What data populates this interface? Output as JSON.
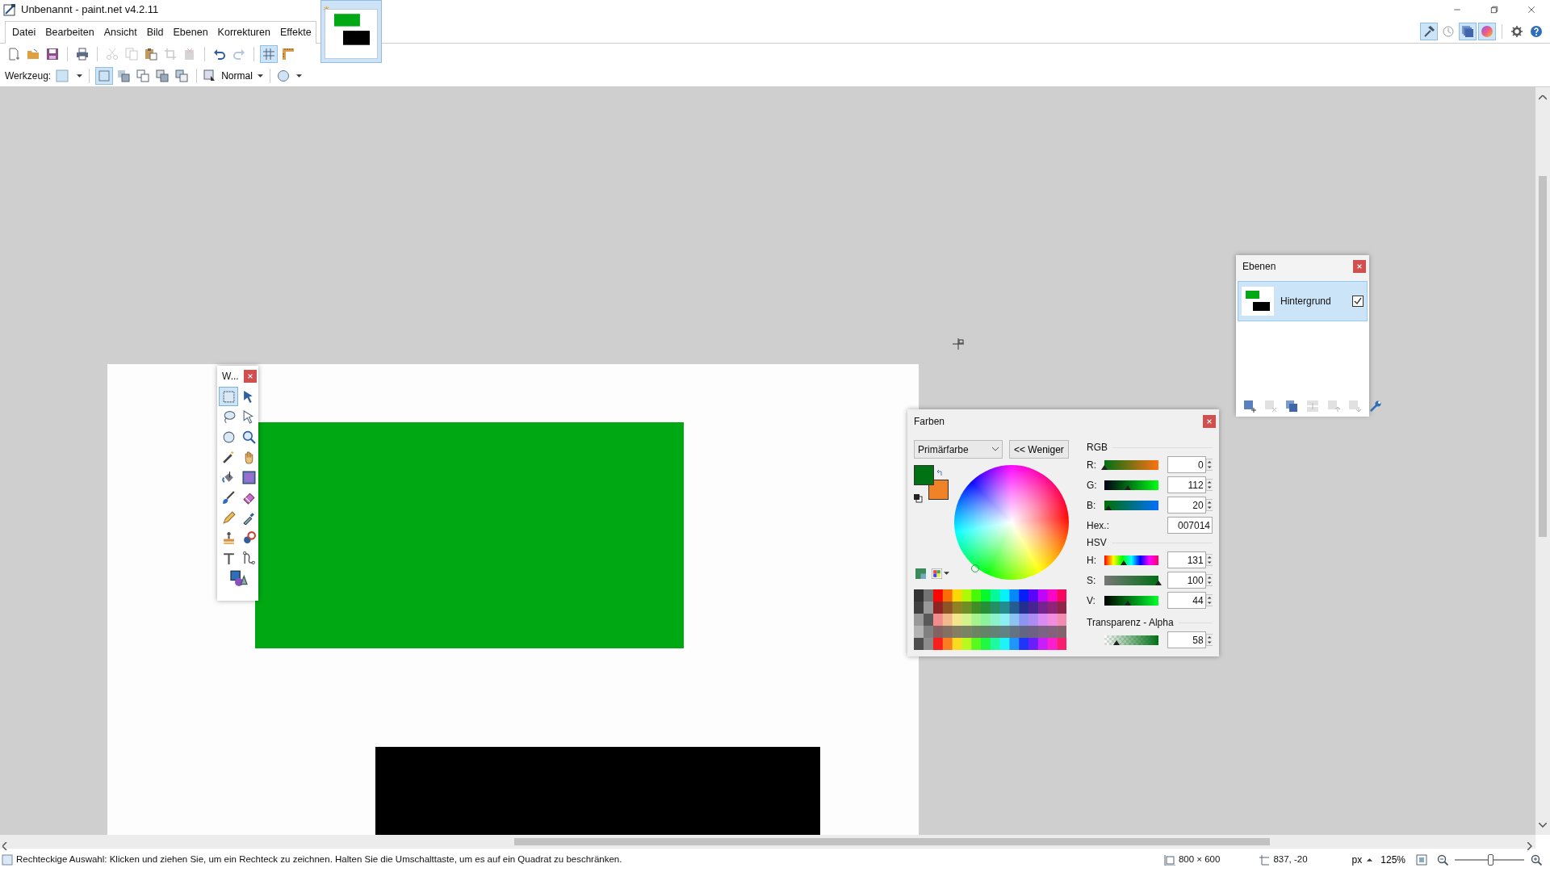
{
  "window": {
    "title": "Unbenannt - paint.net v4.2.11"
  },
  "menu": [
    {
      "label": "Datei"
    },
    {
      "label": "Bearbeiten"
    },
    {
      "label": "Ansicht"
    },
    {
      "label": "Bild"
    },
    {
      "label": "Ebenen"
    },
    {
      "label": "Korrekturen"
    },
    {
      "label": "Effekte"
    }
  ],
  "image_tabs": [
    {
      "selected": true,
      "unsaved": true
    }
  ],
  "toolbar": [
    {
      "disabled": false,
      "pressed": false
    },
    {
      "disabled": false,
      "pressed": false
    },
    {
      "disabled": false,
      "pressed": false
    },
    {
      "disabled": false,
      "pressed": false
    },
    {
      "disabled": true,
      "pressed": false
    },
    {
      "disabled": true,
      "pressed": false
    },
    {
      "disabled": false,
      "pressed": false
    },
    {
      "disabled": true,
      "pressed": false
    },
    {
      "disabled": true,
      "pressed": false
    },
    {
      "disabled": false,
      "pressed": false
    },
    {
      "disabled": true,
      "pressed": false
    },
    {
      "disabled": false,
      "pressed": true
    },
    {
      "disabled": false,
      "pressed": false
    }
  ],
  "panel_toggles": [
    {
      "on": true
    },
    {
      "on": false
    },
    {
      "on": true
    },
    {
      "on": true
    }
  ],
  "tool_options": {
    "label": "Werkzeug:",
    "selection_modes": [
      {
        "selected": true
      },
      {
        "selected": false
      },
      {
        "selected": false
      },
      {
        "selected": false
      },
      {
        "selected": false
      }
    ],
    "blend_mode": "Normal"
  },
  "tools_window": {
    "title": "W...",
    "tools": [
      {
        "selected": true
      },
      {
        "selected": false
      },
      {
        "selected": false
      },
      {
        "selected": false
      },
      {
        "selected": false
      },
      {
        "selected": false
      },
      {
        "selected": false
      },
      {
        "selected": false
      },
      {
        "selected": false
      },
      {
        "selected": false
      },
      {
        "selected": false
      },
      {
        "selected": false
      },
      {
        "selected": false
      },
      {
        "selected": false
      },
      {
        "selected": false
      },
      {
        "selected": false
      },
      {
        "selected": false
      },
      {
        "selected": false
      },
      {
        "selected": false
      }
    ]
  },
  "layers_window": {
    "title": "Ebenen",
    "layers": [
      {
        "name": "Hintergrund",
        "selected": true,
        "visible": true
      }
    ],
    "buttons": [
      {
        "disabled": false
      },
      {
        "disabled": true
      },
      {
        "disabled": false
      },
      {
        "disabled": true
      },
      {
        "disabled": true
      },
      {
        "disabled": true
      },
      {
        "disabled": false
      }
    ]
  },
  "colors_window": {
    "title": "Farben",
    "target": "Primärfarbe",
    "toggle_button": "<< Weniger",
    "swatches": [
      {
        "kind": "primary",
        "color": "#007014"
      },
      {
        "kind": "secondary",
        "color": "#f08228"
      }
    ],
    "rgb_heading": "RGB",
    "rgb": [
      {
        "label": "R:",
        "value": "0",
        "level": 0
      },
      {
        "label": "G:",
        "value": "112",
        "level": 0.44
      },
      {
        "label": "B:",
        "value": "20",
        "level": 0.08
      }
    ],
    "hex_label": "Hex.:",
    "hex": "007014",
    "hsv_heading": "HSV",
    "hsv": [
      {
        "label": "H:",
        "value": "131",
        "level": 0.36
      },
      {
        "label": "S:",
        "value": "100",
        "level": 1
      },
      {
        "label": "V:",
        "value": "44",
        "level": 0.44
      }
    ],
    "alpha_heading": "Transparenz - Alpha",
    "alpha": {
      "value": "58",
      "level": 0.23
    }
  },
  "status_bar": {
    "hint": "Rechteckige Auswahl: Klicken und ziehen Sie, um ein Rechteck zu zeichnen. Halten Sie die Umschalttaste, um es auf ein Quadrat zu beschränken.",
    "image_size": "800 × 600",
    "cursor_position": "837, -20",
    "unit": "px",
    "zoom": "125%",
    "zoom_slider": {
      "level": 0.52
    }
  }
}
